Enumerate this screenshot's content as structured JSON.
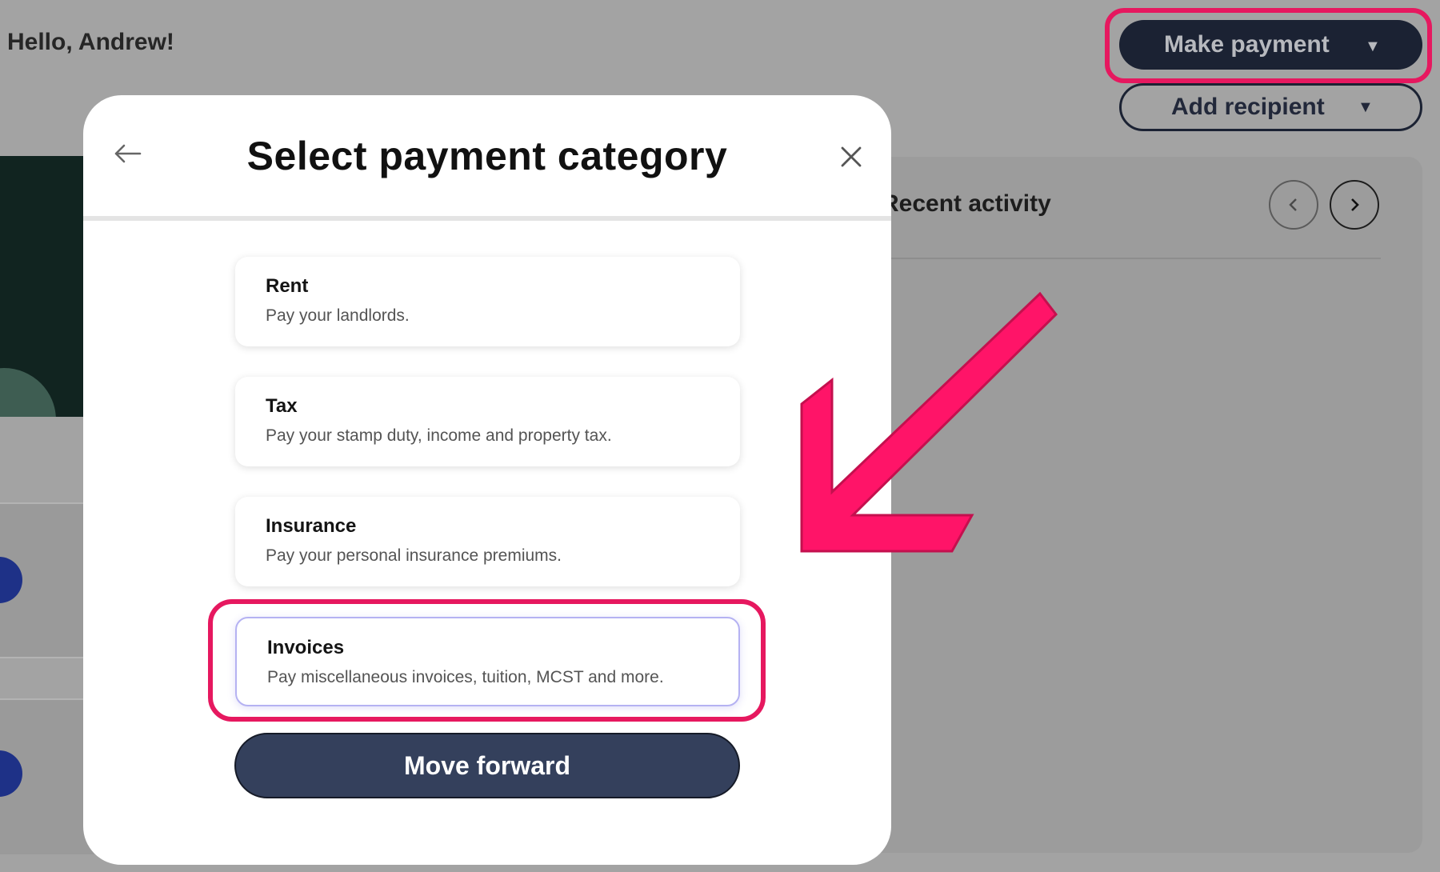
{
  "header": {
    "greeting": "Hello, Andrew!",
    "make_payment_label": "Make payment",
    "add_recipient_label": "Add recipient"
  },
  "activity": {
    "title": "Recent activity"
  },
  "modal": {
    "title": "Select payment category",
    "categories": [
      {
        "title": "Rent",
        "description": "Pay your landlords."
      },
      {
        "title": "Tax",
        "description": "Pay your stamp duty, income and property tax."
      },
      {
        "title": "Insurance",
        "description": "Pay your personal insurance premiums."
      },
      {
        "title": "Invoices",
        "description": "Pay miscellaneous invoices, tuition, MCST and more."
      }
    ],
    "selected_category": "Invoices",
    "submit_label": "Move forward"
  },
  "colors": {
    "highlight": "#e6185f",
    "primary_button": "#34405c",
    "overlay_bg": "#a3a3a3",
    "selected_border": "#b5b2f2"
  },
  "icons": {
    "back": "arrow-left-icon",
    "close": "close-icon",
    "dropdown": "caret-down-icon",
    "prev": "chevron-left-icon",
    "next": "chevron-right-icon",
    "annotation": "pink-arrow-icon"
  }
}
